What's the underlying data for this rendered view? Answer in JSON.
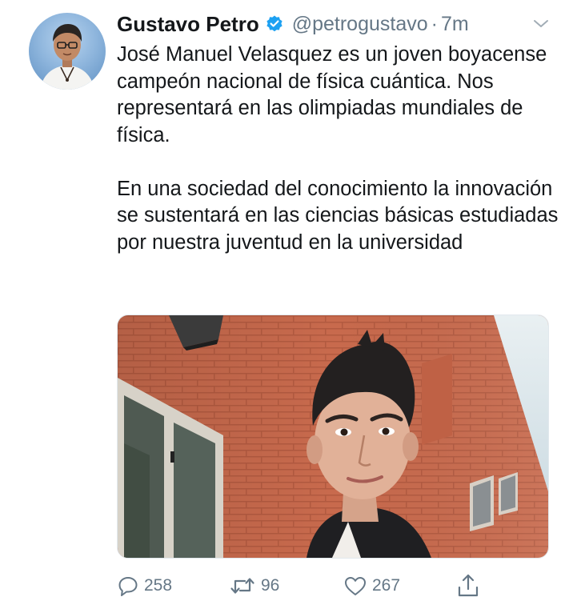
{
  "tweet": {
    "author_name": "Gustavo Petro",
    "verified": true,
    "handle": "@petrogustavo",
    "separator": "·",
    "time": "7m",
    "paragraphs": [
      "José Manuel Velasquez es un joven boyacense campeón nacional de física cuántica. Nos representará en las olimpiadas mundiales de física.",
      "En una sociedad del conocimiento la innovación se sustentará en las ciencias básicas estudiadas por nuestra juventud en la universidad"
    ],
    "media": {
      "kind": "photo"
    },
    "actions": {
      "replies": "258",
      "retweets": "96",
      "likes": "267"
    }
  },
  "icons": {
    "avatar": "avatar-photo",
    "verified": "verified-badge-icon",
    "caret": "chevron-down-icon",
    "reply": "reply-bubble-icon",
    "retweet": "retweet-icon",
    "like": "heart-icon",
    "share": "share-upload-icon"
  },
  "colors": {
    "text": "#14171a",
    "secondary": "#657786",
    "verified": "#1da1f2",
    "background": "#ffffff"
  }
}
